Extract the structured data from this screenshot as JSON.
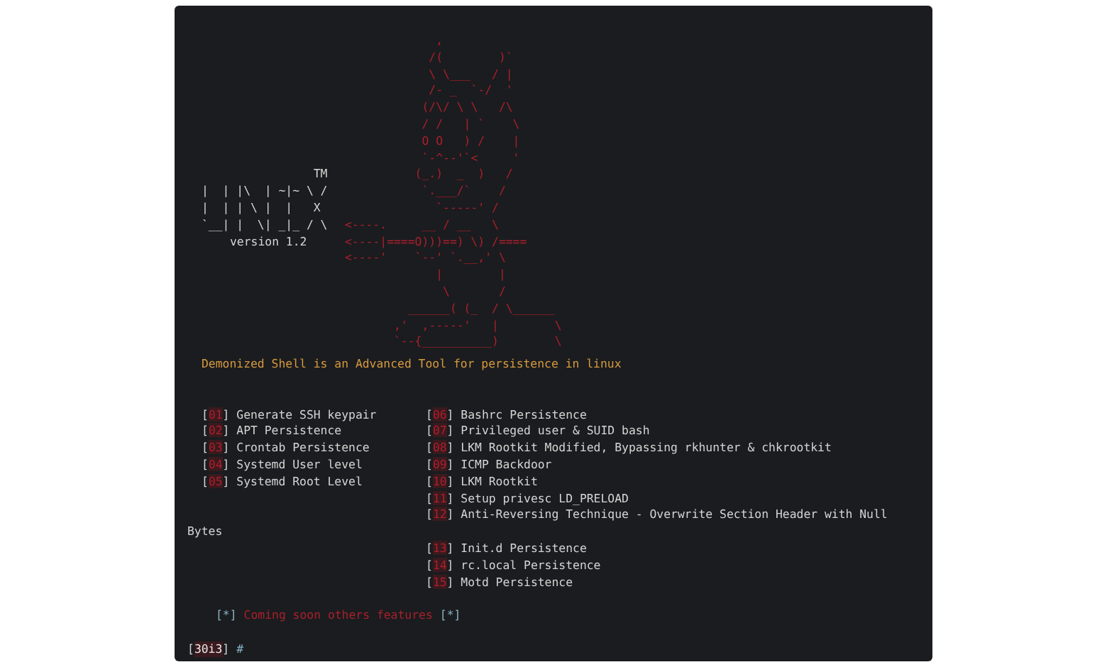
{
  "banner": {
    "logo_lines": [
      "                TM",
      "|  | |\\  | ~|~ \\ /",
      "|  | | \\ |  |   X",
      "`__| |  \\| _|_ / \\"
    ],
    "version": "version 1.2",
    "art_lines": [
      "             ,",
      "            /(        )`",
      "            \\ \\___   / |",
      "            /- _  `-/  '",
      "           (/\\/ \\ \\   /\\",
      "           / /   | `    \\",
      "           O O   ) /    |",
      "           `-^--'`<     '",
      "          (_.)  _  )   /",
      "           `.___/`    /",
      "             `-----' /",
      "<----.     __ / __   \\",
      "<----|====O)))==) \\) /====",
      "<----'    `--' `.__,' \\",
      "             |        |",
      "              \\       /",
      "         ______( (_  / \\______",
      "       ,'  ,-----'   |        \\",
      "       `--{__________)        \\"
    ]
  },
  "tagline": "Demonized Shell is an Advanced Tool for persistence in linux",
  "menu": {
    "left": [
      {
        "open": "[",
        "number": "01",
        "close": "]",
        "label": "Generate SSH keypair"
      },
      {
        "open": "[",
        "number": "02",
        "close": "]",
        "label": "APT Persistence"
      },
      {
        "open": "[",
        "number": "03",
        "close": "]",
        "label": "Crontab Persistence"
      },
      {
        "open": "[",
        "number": "04",
        "close": "]",
        "label": "Systemd User level"
      },
      {
        "open": "[",
        "number": "05",
        "close": "]",
        "label": "Systemd Root Level"
      }
    ],
    "right_top": [
      {
        "open": "[",
        "number": "06",
        "close": "]",
        "label": "Bashrc Persistence"
      },
      {
        "open": "[",
        "number": "07",
        "close": "]",
        "label": "Privileged user & SUID bash"
      },
      {
        "open": "[",
        "number": "08",
        "close": "]",
        "label": "LKM Rootkit Modified, Bypassing rkhunter & chkrootkit"
      },
      {
        "open": "[",
        "number": "09",
        "close": "]",
        "label": "ICMP Backdoor"
      },
      {
        "open": "[",
        "number": "10",
        "close": "]",
        "label": "LKM Rootkit"
      },
      {
        "open": "[",
        "number": "11",
        "close": "]",
        "label": "Setup privesc LD_PRELOAD"
      },
      {
        "open": "[",
        "number": "12",
        "close": "]",
        "label": "Anti-Reversing Technique - Overwrite Section Header with Null"
      }
    ],
    "wrap_overflow": "Bytes",
    "right_bottom": [
      {
        "open": "[",
        "number": "13",
        "close": "]",
        "label": "Init.d Persistence"
      },
      {
        "open": "[",
        "number": "14",
        "close": "]",
        "label": "rc.local Persistence"
      },
      {
        "open": "[",
        "number": "15",
        "close": "]",
        "label": "Motd Persistence"
      }
    ]
  },
  "notice": {
    "mark_left": "[*]",
    "text": "Coming soon others features",
    "mark_right": "[*]"
  },
  "prompt": {
    "open": "[",
    "host": "30i3",
    "close": "]",
    "symbol": "#"
  }
}
